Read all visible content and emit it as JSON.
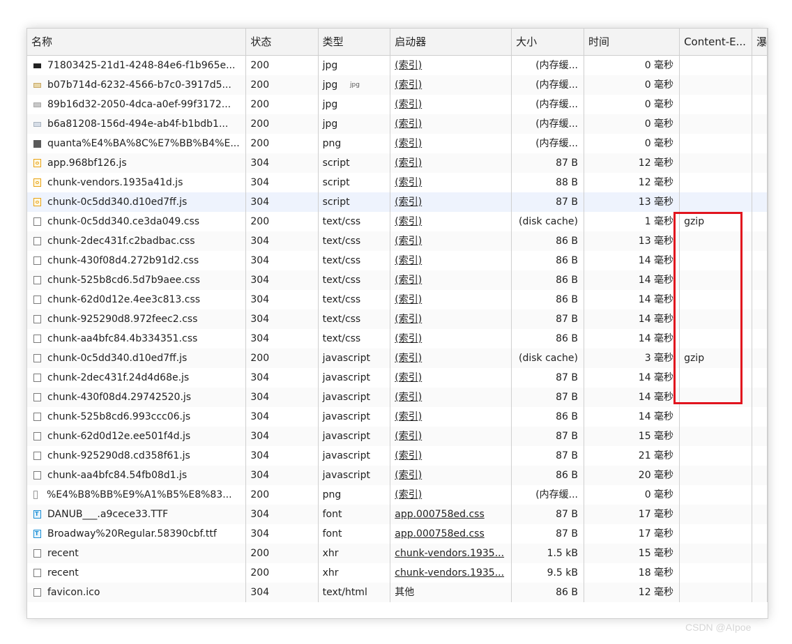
{
  "columns": [
    "名称",
    "状态",
    "类型",
    "启动器",
    "大小",
    "时间",
    "Content-E...",
    "瀑"
  ],
  "overflow_hint": "jpg",
  "rows": [
    {
      "name": "71803425-21d1-4248-84e6-f1b965e...",
      "icon": "image-icon",
      "status": "200",
      "type": "jpg",
      "initiator": "(索引)",
      "size": "(内存缓...",
      "time": "0 毫秒",
      "encoding": ""
    },
    {
      "name": "b07b714d-6232-4566-b7c0-3917d5...",
      "icon": "image-icon",
      "status": "200",
      "type": "jpg",
      "initiator": "(索引)",
      "size": "(内存缓...",
      "time": "0 毫秒",
      "encoding": ""
    },
    {
      "name": "89b16d32-2050-4dca-a0ef-99f3172...",
      "icon": "image-icon",
      "status": "200",
      "type": "jpg",
      "initiator": "(索引)",
      "size": "(内存缓...",
      "time": "0 毫秒",
      "encoding": ""
    },
    {
      "name": "b6a81208-156d-494e-ab4f-b1bdb1...",
      "icon": "image-icon",
      "status": "200",
      "type": "jpg",
      "initiator": "(索引)",
      "size": "(内存缓...",
      "time": "0 毫秒",
      "encoding": ""
    },
    {
      "name": "quanta%E4%BA%8C%E7%BB%B4%E...",
      "icon": "image-icon",
      "status": "200",
      "type": "png",
      "initiator": "(索引)",
      "size": "(内存缓...",
      "time": "0 毫秒",
      "encoding": ""
    },
    {
      "name": "app.968bf126.js",
      "icon": "script-icon",
      "status": "304",
      "type": "script",
      "initiator": "(索引)",
      "size": "87 B",
      "time": "12 毫秒",
      "encoding": ""
    },
    {
      "name": "chunk-vendors.1935a41d.js",
      "icon": "script-icon",
      "status": "304",
      "type": "script",
      "initiator": "(索引)",
      "size": "88 B",
      "time": "12 毫秒",
      "encoding": ""
    },
    {
      "name": "chunk-0c5dd340.d10ed7ff.js",
      "icon": "script-icon",
      "status": "304",
      "type": "script",
      "initiator": "(索引)",
      "size": "87 B",
      "time": "13 毫秒",
      "encoding": ""
    },
    {
      "name": "chunk-0c5dd340.ce3da049.css",
      "icon": "document-icon",
      "status": "200",
      "type": "text/css",
      "initiator": "(索引)",
      "size": "(disk cache)",
      "time": "1 毫秒",
      "encoding": "gzip"
    },
    {
      "name": "chunk-2dec431f.c2badbac.css",
      "icon": "document-icon",
      "status": "304",
      "type": "text/css",
      "initiator": "(索引)",
      "size": "86 B",
      "time": "13 毫秒",
      "encoding": ""
    },
    {
      "name": "chunk-430f08d4.272b91d2.css",
      "icon": "document-icon",
      "status": "304",
      "type": "text/css",
      "initiator": "(索引)",
      "size": "86 B",
      "time": "14 毫秒",
      "encoding": ""
    },
    {
      "name": "chunk-525b8cd6.5d7b9aee.css",
      "icon": "document-icon",
      "status": "304",
      "type": "text/css",
      "initiator": "(索引)",
      "size": "86 B",
      "time": "14 毫秒",
      "encoding": ""
    },
    {
      "name": "chunk-62d0d12e.4ee3c813.css",
      "icon": "document-icon",
      "status": "304",
      "type": "text/css",
      "initiator": "(索引)",
      "size": "86 B",
      "time": "14 毫秒",
      "encoding": ""
    },
    {
      "name": "chunk-925290d8.972feec2.css",
      "icon": "document-icon",
      "status": "304",
      "type": "text/css",
      "initiator": "(索引)",
      "size": "87 B",
      "time": "14 毫秒",
      "encoding": ""
    },
    {
      "name": "chunk-aa4bfc84.4b334351.css",
      "icon": "document-icon",
      "status": "304",
      "type": "text/css",
      "initiator": "(索引)",
      "size": "86 B",
      "time": "14 毫秒",
      "encoding": ""
    },
    {
      "name": "chunk-0c5dd340.d10ed7ff.js",
      "icon": "document-icon",
      "status": "200",
      "type": "javascript",
      "initiator": "(索引)",
      "size": "(disk cache)",
      "time": "3 毫秒",
      "encoding": "gzip"
    },
    {
      "name": "chunk-2dec431f.24d4d68e.js",
      "icon": "document-icon",
      "status": "304",
      "type": "javascript",
      "initiator": "(索引)",
      "size": "87 B",
      "time": "14 毫秒",
      "encoding": ""
    },
    {
      "name": "chunk-430f08d4.29742520.js",
      "icon": "document-icon",
      "status": "304",
      "type": "javascript",
      "initiator": "(索引)",
      "size": "87 B",
      "time": "14 毫秒",
      "encoding": ""
    },
    {
      "name": "chunk-525b8cd6.993ccc06.js",
      "icon": "document-icon",
      "status": "304",
      "type": "javascript",
      "initiator": "(索引)",
      "size": "86 B",
      "time": "14 毫秒",
      "encoding": ""
    },
    {
      "name": "chunk-62d0d12e.ee501f4d.js",
      "icon": "document-icon",
      "status": "304",
      "type": "javascript",
      "initiator": "(索引)",
      "size": "87 B",
      "time": "15 毫秒",
      "encoding": ""
    },
    {
      "name": "chunk-925290d8.cd358f61.js",
      "icon": "document-icon",
      "status": "304",
      "type": "javascript",
      "initiator": "(索引)",
      "size": "87 B",
      "time": "21 毫秒",
      "encoding": ""
    },
    {
      "name": "chunk-aa4bfc84.54fb08d1.js",
      "icon": "document-icon",
      "status": "304",
      "type": "javascript",
      "initiator": "(索引)",
      "size": "86 B",
      "time": "20 毫秒",
      "encoding": ""
    },
    {
      "name": "%E4%B8%BB%E9%A1%B5%E8%83...",
      "icon": "document-icon",
      "status": "200",
      "type": "png",
      "initiator": "(索引)",
      "size": "(内存缓...",
      "time": "0 毫秒",
      "encoding": ""
    },
    {
      "name": "DANUB___.a9cece33.TTF",
      "icon": "font-icon",
      "status": "304",
      "type": "font",
      "initiator": "app.000758ed.css",
      "size": "87 B",
      "time": "17 毫秒",
      "encoding": ""
    },
    {
      "name": "Broadway%20Regular.58390cbf.ttf",
      "icon": "font-icon",
      "status": "304",
      "type": "font",
      "initiator": "app.000758ed.css",
      "size": "87 B",
      "time": "17 毫秒",
      "encoding": ""
    },
    {
      "name": "recent",
      "icon": "document-icon",
      "status": "200",
      "type": "xhr",
      "initiator": "chunk-vendors.1935...",
      "size": "1.5 kB",
      "time": "15 毫秒",
      "encoding": ""
    },
    {
      "name": "recent",
      "icon": "document-icon",
      "status": "200",
      "type": "xhr",
      "initiator": "chunk-vendors.1935...",
      "size": "9.5 kB",
      "time": "18 毫秒",
      "encoding": ""
    },
    {
      "name": "favicon.ico",
      "icon": "document-icon",
      "status": "304",
      "type": "text/html",
      "initiator": "其他",
      "size": "86 B",
      "time": "12 毫秒",
      "encoding": ""
    }
  ],
  "highlight_color": "#e1141e",
  "watermark": "CSDN @AIpoe"
}
